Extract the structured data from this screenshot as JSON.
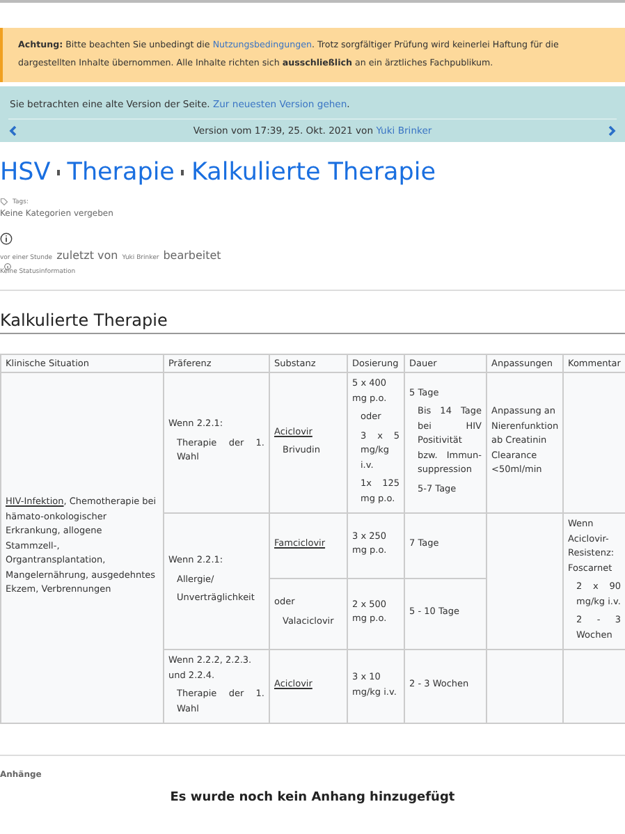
{
  "notice": {
    "label": "Achtung:",
    "parts": [
      {
        "text": " Bitte beachten Sie unbedingt die "
      },
      {
        "text": "Nutzungsbedingungen",
        "link": true
      },
      {
        "text": ". Trotz sorgfältiger Prüfung wird keinerlei Haftung für die dargestellten Inhalte übernommen. Alle Inhalte richten sich **ausschließlich** an ein ärztliches Fachpublikum."
      }
    ]
  },
  "version_banner": {
    "message": "Sie betrachten eine alte Version der Seite.",
    "link": "Zur neuesten Version gehen",
    "after": ".",
    "version_text": "Version vom 17:39, 25. Okt. 2021 von",
    "author": "Yuki Brinker"
  },
  "breadcrumb": [
    {
      "label": "HSV"
    },
    {
      "label": "Therapie"
    },
    {
      "label": "Kalkulierte Therapie"
    }
  ],
  "tags": {
    "label": "Tags:",
    "value": "Keine Kategorien vergeben"
  },
  "edit_info": {
    "time": "vor einer Stunde",
    "text1": "zuletzt von",
    "user": "Yuki Brinker",
    "text2": "bearbeitet",
    "status": "Keine Statusinformation"
  },
  "section_title": "Kalkulierte Therapie",
  "table": {
    "columns": [
      "Klinische Situation",
      "Präferenz",
      "Substanz",
      "Dosierung",
      "Dauer",
      "Anpassungen",
      "Kommentar"
    ],
    "rows": [
      {
        "cells": [
          {
            "rowspan": 4,
            "paragraphs": [
              {
                "parts": [
                  {
                    "text": "HIV-Infektion",
                    "link": true
                  },
                  {
                    "text": ", Chemotherapie bei hämato-onkologischer Erkrankung, allogene Stammzell-, Organtransplantation, Mangelernährung, ausgedehntes Ekzem, Verbrennungen"
                  }
                ]
              }
            ]
          },
          {
            "paragraphs": [
              {
                "parts": [
                  {
                    "text": "Wenn 2.2.1:"
                  }
                ]
              },
              {
                "indent": true,
                "parts": [
                  {
                    "text": "Therapie der 1. Wahl"
                  }
                ]
              }
            ]
          },
          {
            "paragraphs": [
              {
                "parts": [
                  {
                    "text": "Aciclovir",
                    "link": true
                  }
                ]
              },
              {
                "indent": true,
                "parts": [
                  {
                    "text": "Brivudin"
                  }
                ]
              }
            ]
          },
          {
            "paragraphs": [
              {
                "parts": [
                  {
                    "text": "5 x 400 mg p.o."
                  }
                ]
              },
              {
                "indent": true,
                "parts": [
                  {
                    "text": "oder"
                  }
                ]
              },
              {
                "indent": true,
                "parts": [
                  {
                    "text": "3 x 5 mg/kg i.v."
                  }
                ]
              },
              {
                "indent": true,
                "parts": [
                  {
                    "text": "1x 125 mg p.o."
                  }
                ]
              }
            ]
          },
          {
            "paragraphs": [
              {
                "parts": [
                  {
                    "text": "5 Tage"
                  }
                ]
              },
              {
                "indent": true,
                "parts": [
                  {
                    "text": "Bis 14 Tage bei HIV Positivität bzw. Immun-suppression"
                  }
                ]
              },
              {
                "indent": true,
                "parts": [
                  {
                    "text": "5-7 Tage"
                  }
                ]
              }
            ]
          },
          {
            "paragraphs": [
              {
                "parts": [
                  {
                    "text": "Anpassung an Nierenfunktion ab Creatinin Clearance <50ml/min"
                  }
                ]
              }
            ]
          },
          {}
        ]
      },
      {
        "cells": [
          {
            "rowspan": 2,
            "paragraphs": [
              {
                "parts": [
                  {
                    "text": "Wenn 2.2.1:"
                  }
                ]
              },
              {
                "indent": true,
                "parts": [
                  {
                    "text": "Allergie/"
                  }
                ]
              },
              {
                "indent": true,
                "parts": [
                  {
                    "text": "Unverträglichkeit"
                  }
                ]
              }
            ]
          },
          {
            "paragraphs": [
              {
                "parts": [
                  {
                    "text": "Famciclovir",
                    "link": true
                  }
                ]
              }
            ]
          },
          {
            "paragraphs": [
              {
                "parts": [
                  {
                    "text": "3 x 250 mg p.o."
                  }
                ]
              }
            ]
          },
          {
            "paragraphs": [
              {
                "parts": [
                  {
                    "text": "7 Tage"
                  }
                ]
              }
            ]
          },
          {
            "rowspan": 2
          },
          {
            "rowspan": 2,
            "paragraphs": [
              {
                "parts": [
                  {
                    "text": "Wenn Aciclovir-Resistenz: Foscarnet"
                  }
                ]
              },
              {
                "indent": true,
                "parts": [
                  {
                    "text": "2 x 90 mg/kg i.v."
                  }
                ]
              },
              {
                "indent": true,
                "parts": [
                  {
                    "text": "2 - 3 Wochen"
                  }
                ]
              }
            ]
          }
        ]
      },
      {
        "cells": [
          {
            "paragraphs": [
              {
                "parts": [
                  {
                    "text": "oder"
                  }
                ]
              },
              {
                "indent": true,
                "parts": [
                  {
                    "text": "Valaciclovir"
                  }
                ]
              }
            ]
          },
          {
            "paragraphs": [
              {
                "parts": [
                  {
                    "text": "2 x 500 mg p.o."
                  }
                ]
              }
            ]
          },
          {
            "paragraphs": [
              {
                "parts": [
                  {
                    "text": "5 - 10 Tage"
                  }
                ]
              }
            ]
          }
        ]
      },
      {
        "cells": [
          {
            "paragraphs": [
              {
                "parts": [
                  {
                    "text": "Wenn 2.2.2, 2.2.3. und 2.2.4."
                  }
                ]
              },
              {
                "indent": true,
                "parts": [
                  {
                    "text": "Therapie der 1. Wahl"
                  }
                ]
              }
            ]
          },
          {
            "paragraphs": [
              {
                "parts": [
                  {
                    "text": "Aciclovir",
                    "link": true
                  }
                ]
              }
            ]
          },
          {
            "paragraphs": [
              {
                "parts": [
                  {
                    "text": "3 x 10 mg/kg i.v."
                  }
                ]
              }
            ]
          },
          {
            "paragraphs": [
              {
                "parts": [
                  {
                    "text": "2 - 3 Wochen"
                  }
                ]
              }
            ]
          },
          {},
          {}
        ]
      }
    ]
  },
  "attachments": {
    "title": "Anhänge",
    "empty_text": "Es wurde noch kein Anhang hinzugefügt"
  }
}
